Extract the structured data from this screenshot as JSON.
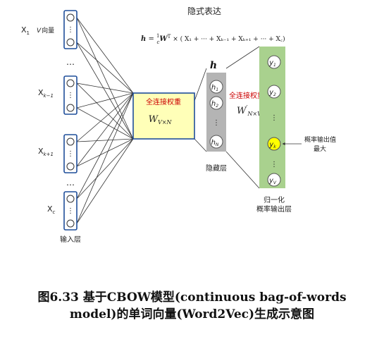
{
  "input_layer": {
    "vectors": [
      {
        "label": "X",
        "sub": "1"
      },
      {
        "label": "X",
        "sub": "k−1"
      },
      {
        "label": "X",
        "sub": "k+1"
      },
      {
        "label": "X",
        "sub": "c"
      }
    ],
    "vector_note_v": "V",
    "vector_note_text": "向量",
    "ellipsis": "…",
    "vdots": "⋮",
    "title": "输入层"
  },
  "weight_in": {
    "fc_label": "全连接权重",
    "symbol": "W",
    "symbol_sub": "V×N",
    "color_fill": "#ffffb8",
    "color_border": "#1f4e9a",
    "color_label": "#cc0000"
  },
  "formula": {
    "title": "隐式表达",
    "expr_lhs": "h",
    "expr_eq": " = ",
    "expr_frac_num": "1",
    "expr_frac_den": "c",
    "expr_w": "W",
    "expr_sup": "T",
    "expr_rest": " × ( X₁ + ··· + Xₖ₋₁ + Xₖ₊₁ + ··· + X꜀)"
  },
  "hidden_layer": {
    "title": "h",
    "nodes": [
      {
        "label": "h",
        "sub": "1"
      },
      {
        "label": "h",
        "sub": "2"
      },
      {
        "label": "h",
        "sub": "N"
      }
    ],
    "vdots": "⋮",
    "caption": "隐藏层",
    "color_fill": "#b4b4b4"
  },
  "weight_out": {
    "fc_label": "全连接权重",
    "symbol": "W",
    "symbol_prime": "′",
    "symbol_sub": "N×V",
    "color_label": "#cc0000"
  },
  "output_layer": {
    "nodes": [
      {
        "label": "y",
        "sub": "1"
      },
      {
        "label": "y",
        "sub": "2"
      },
      {
        "label": "y",
        "sub": "k",
        "highlight": true
      },
      {
        "label": "y",
        "sub": "V"
      }
    ],
    "vdots": "⋮",
    "caption_line1": "归一化",
    "caption_line2": "概率输出层",
    "annotation_line1": "概率输出值",
    "annotation_line2": "最大",
    "color_fill": "#a9d18e",
    "color_highlight": "#ffff00"
  },
  "caption": {
    "line1": "图6.33 基于CBOW模型(continuous bag-of-words",
    "line2": "model)的单词向量(Word2Vec)生成示意图"
  }
}
